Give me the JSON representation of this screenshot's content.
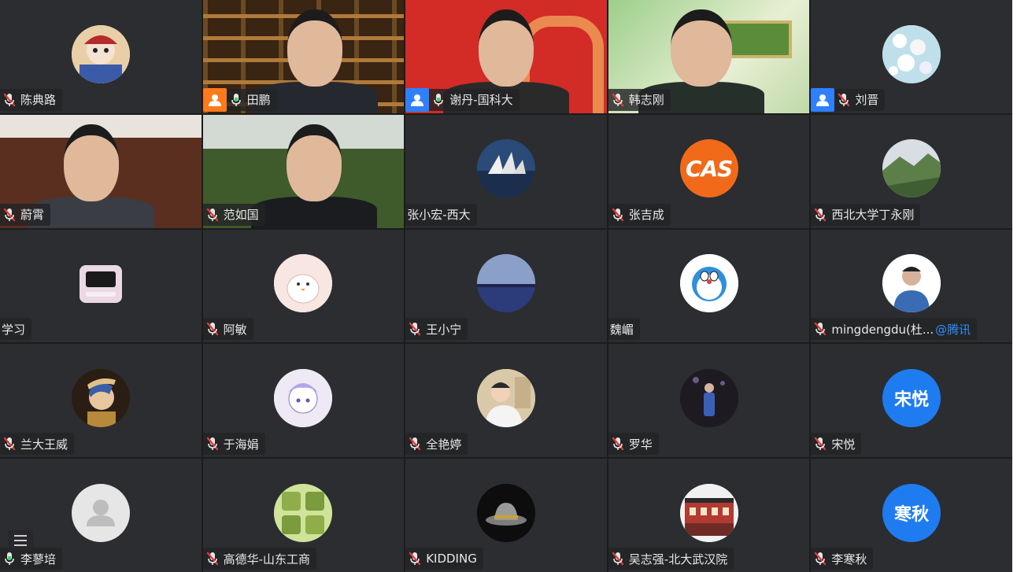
{
  "participants": [
    {
      "name": "陈典路",
      "mic": "muted",
      "type": "avatar",
      "avatar_style": "opera",
      "colors": [
        "#f3d9b8",
        "#b52a2a"
      ]
    },
    {
      "name": "田鹏",
      "mic": "on",
      "type": "video",
      "video_style": "bookshelf",
      "host_badge": true,
      "host_color": "#ff7a1a"
    },
    {
      "name": "谢丹-国科大",
      "mic": "on",
      "type": "video",
      "video_style": "red-banner",
      "host_badge": true,
      "host_color": "#2f80ff"
    },
    {
      "name": "韩志刚",
      "mic": "muted",
      "type": "video",
      "video_style": "green-room"
    },
    {
      "name": "刘晋",
      "mic": "muted",
      "type": "avatar",
      "avatar_style": "flowers",
      "host_badge": true,
      "host_color": "#2f80ff",
      "colors": [
        "#cfe4ef",
        "#ffffff"
      ]
    },
    {
      "name": "蔚霄",
      "mic": "muted",
      "type": "video",
      "video_style": "cabinet"
    },
    {
      "name": "范如国",
      "mic": "muted",
      "type": "video",
      "video_style": "outdoor"
    },
    {
      "name": "张小宏-西大",
      "mic": "none",
      "type": "avatar",
      "avatar_style": "opera-house",
      "colors": [
        "#2a4a78",
        "#e8e8e8"
      ]
    },
    {
      "name": "张吉成",
      "mic": "muted",
      "type": "avatar",
      "avatar_style": "text",
      "avatar_text": "CAS",
      "colors": [
        "#f06a1a",
        "#ffffff"
      ]
    },
    {
      "name": "西北大学丁永刚",
      "mic": "muted",
      "type": "avatar",
      "avatar_style": "mountain",
      "colors": [
        "#7d9b6a",
        "#d9dde4"
      ]
    },
    {
      "name": "学习",
      "mic": "none",
      "type": "avatar",
      "avatar_style": "pink-device",
      "colors": [
        "#ead8e3",
        "#2b2d30"
      ]
    },
    {
      "name": "阿敏",
      "mic": "muted",
      "type": "avatar",
      "avatar_style": "cartoon-bird",
      "colors": [
        "#f7e6e1",
        "#ffffff"
      ]
    },
    {
      "name": "王小宁",
      "mic": "muted",
      "type": "avatar",
      "avatar_style": "dusk-lake",
      "colors": [
        "#2c3c7a",
        "#8aa0c8"
      ]
    },
    {
      "name": "魏嵋",
      "mic": "none",
      "type": "avatar",
      "avatar_style": "doraemon",
      "colors": [
        "#ffffff",
        "#2f8fdc"
      ]
    },
    {
      "name": "mingdengdu(杜...",
      "mic": "muted",
      "type": "avatar",
      "avatar_style": "portrait",
      "tag": "@腾讯",
      "colors": [
        "#ffffff",
        "#3a6cb5"
      ]
    },
    {
      "name": "兰大王威",
      "mic": "muted",
      "type": "avatar",
      "avatar_style": "pearl-earring",
      "colors": [
        "#3b2a1d",
        "#e2c08a"
      ]
    },
    {
      "name": "于海娟",
      "mic": "muted",
      "type": "avatar",
      "avatar_style": "anime",
      "colors": [
        "#efe9f6",
        "#8a72c8"
      ]
    },
    {
      "name": "全艳婷",
      "mic": "muted",
      "type": "avatar",
      "avatar_style": "photo",
      "colors": [
        "#d9c9a8",
        "#3a3a3a"
      ]
    },
    {
      "name": "罗华",
      "mic": "muted",
      "type": "avatar",
      "avatar_style": "stage",
      "colors": [
        "#1d1a22",
        "#3a5fb8"
      ]
    },
    {
      "name": "宋悦",
      "mic": "muted",
      "type": "avatar",
      "avatar_style": "text",
      "avatar_text": "宋悦",
      "colors": [
        "#1f7cf0",
        "#ffffff"
      ]
    },
    {
      "name": "李蓼培",
      "mic": "on",
      "type": "avatar",
      "avatar_style": "default",
      "colors": [
        "#e6e6e6",
        "#cfcfcf"
      ]
    },
    {
      "name": "高德华-山东工商",
      "mic": "muted",
      "type": "avatar",
      "avatar_style": "plants",
      "colors": [
        "#8fae4a",
        "#cfe39a"
      ]
    },
    {
      "name": "KIDDING",
      "mic": "muted",
      "type": "avatar",
      "avatar_style": "hat",
      "colors": [
        "#0d0d0d",
        "#7c7c7c"
      ]
    },
    {
      "name": "吴志强-北大武汉院",
      "mic": "muted",
      "type": "avatar",
      "avatar_style": "building",
      "colors": [
        "#f1f1f1",
        "#b23a32"
      ]
    },
    {
      "name": "李寒秋",
      "mic": "muted",
      "type": "avatar",
      "avatar_style": "text",
      "avatar_text": "寒秋",
      "colors": [
        "#1f7cf0",
        "#ffffff"
      ]
    }
  ]
}
